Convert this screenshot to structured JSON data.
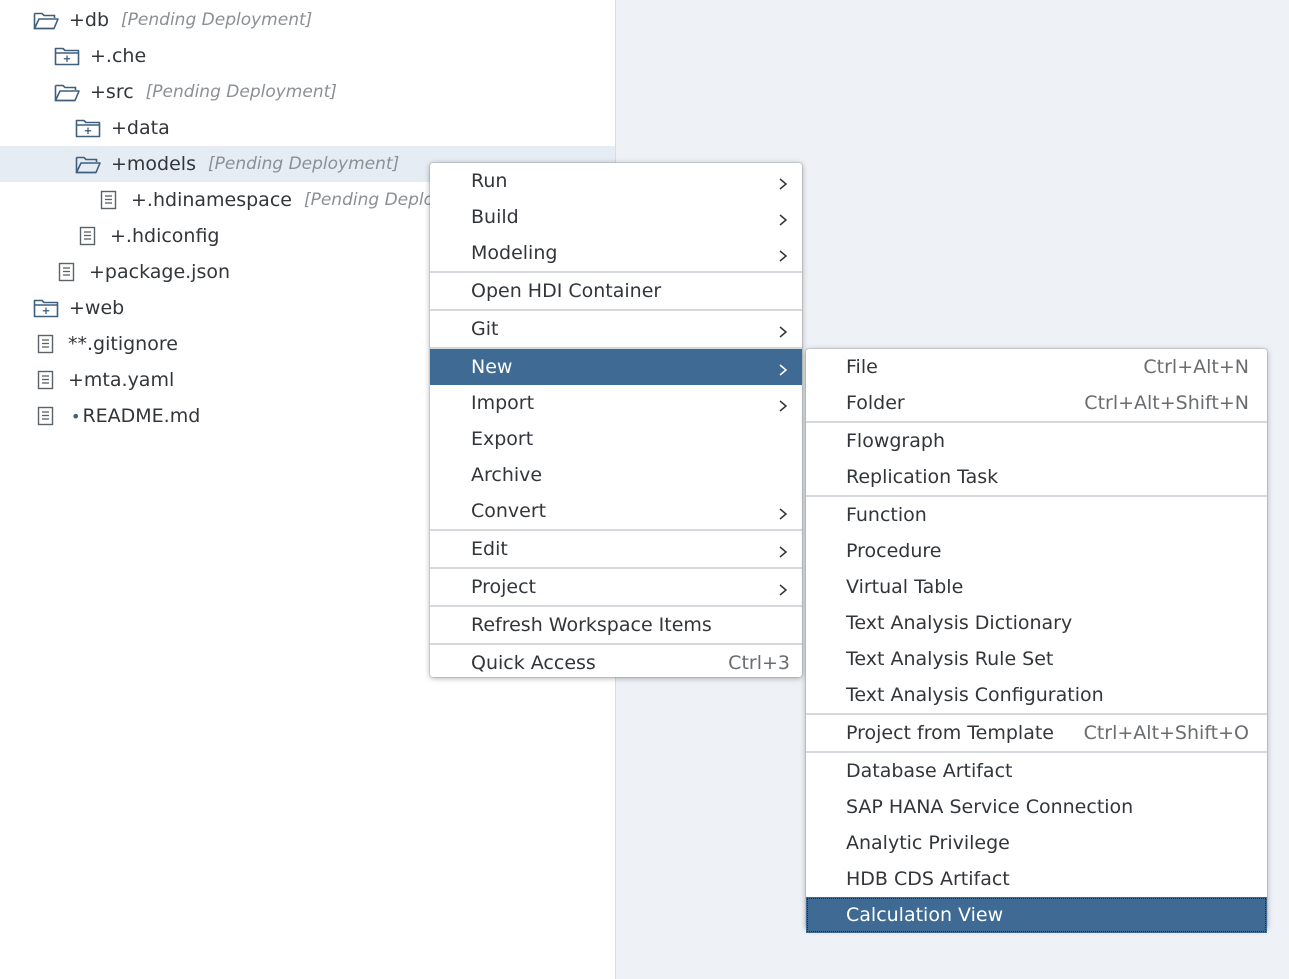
{
  "tree": [
    {
      "icon": "folder-open-icon",
      "prefix": "+",
      "name": "db",
      "status": "[Pending Deployment]",
      "indent": 0
    },
    {
      "icon": "folder-closed-icon",
      "prefix": "+",
      "name": ".che",
      "status": "",
      "indent": 1
    },
    {
      "icon": "folder-open-icon",
      "prefix": "+",
      "name": "src",
      "status": "[Pending Deployment]",
      "indent": 1
    },
    {
      "icon": "folder-closed-icon",
      "prefix": "+",
      "name": "data",
      "status": "",
      "indent": 2
    },
    {
      "icon": "folder-open-icon",
      "prefix": "+",
      "name": "models",
      "status": "[Pending Deployment]",
      "indent": 2,
      "selected": true
    },
    {
      "icon": "file-icon",
      "prefix": "+",
      "name": ".hdinamespace",
      "status": "[Pending Deploy",
      "indent": 3
    },
    {
      "icon": "file-icon",
      "prefix": "+",
      "name": ".hdiconfig",
      "status": "",
      "indent": 2
    },
    {
      "icon": "file-icon",
      "prefix": "+",
      "name": "package.json",
      "status": "",
      "indent": 1
    },
    {
      "icon": "folder-closed-icon",
      "prefix": "+",
      "name": "web",
      "status": "",
      "indent": 0
    },
    {
      "icon": "file-icon",
      "prefix": "**",
      "name": ".gitignore",
      "status": "",
      "indent": 0
    },
    {
      "icon": "file-icon",
      "prefix": "+",
      "name": "mta.yaml",
      "status": "",
      "indent": 0
    },
    {
      "icon": "file-icon",
      "prefix": "•",
      "name": "README.md",
      "status": "",
      "indent": 0
    }
  ],
  "context_menu": {
    "items": [
      {
        "label": "Run",
        "submenu": true
      },
      {
        "label": "Build",
        "submenu": true
      },
      {
        "label": "Modeling",
        "submenu": true,
        "sep_after": true
      },
      {
        "label": "Open HDI Container",
        "sep_after": true
      },
      {
        "label": "Git",
        "submenu": true,
        "sep_after": true
      },
      {
        "label": "New",
        "submenu": true,
        "hover": true
      },
      {
        "label": "Import",
        "submenu": true
      },
      {
        "label": "Export"
      },
      {
        "label": "Archive"
      },
      {
        "label": "Convert",
        "submenu": true,
        "sep_after": true
      },
      {
        "label": "Edit",
        "submenu": true,
        "sep_after": true
      },
      {
        "label": "Project",
        "submenu": true,
        "sep_after": true
      },
      {
        "label": "Refresh Workspace Items",
        "sep_after": true
      },
      {
        "label": "Quick Access",
        "shortcut": "Ctrl+3"
      }
    ]
  },
  "new_submenu": {
    "items": [
      {
        "label": "File",
        "shortcut": "Ctrl+Alt+N"
      },
      {
        "label": "Folder",
        "shortcut": "Ctrl+Alt+Shift+N",
        "sep_after": true
      },
      {
        "label": "Flowgraph"
      },
      {
        "label": "Replication Task",
        "sep_after": true
      },
      {
        "label": "Function"
      },
      {
        "label": "Procedure"
      },
      {
        "label": "Virtual Table"
      },
      {
        "label": "Text Analysis Dictionary"
      },
      {
        "label": "Text Analysis Rule Set"
      },
      {
        "label": "Text Analysis Configuration",
        "sep_after": true
      },
      {
        "label": "Project from Template",
        "shortcut": "Ctrl+Alt+Shift+O",
        "sep_after": true
      },
      {
        "label": "Database Artifact"
      },
      {
        "label": "SAP HANA Service Connection"
      },
      {
        "label": "Analytic Privilege"
      },
      {
        "label": "HDB CDS Artifact"
      },
      {
        "label": "Calculation View",
        "hover": true,
        "focused": true
      }
    ]
  },
  "colors": {
    "highlight": "#3e6a94",
    "selected_row": "#e6ecf3",
    "status_text": "#8c9094",
    "right_pane": "#eef1f6"
  }
}
